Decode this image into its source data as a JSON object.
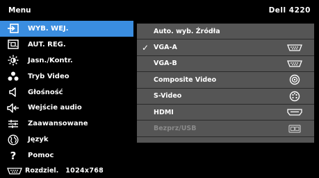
{
  "header": {
    "title": "Menu",
    "model": "Dell 4220"
  },
  "left_menu": {
    "items": [
      {
        "label": "WYB. WEJ.",
        "icon": "input-source-icon"
      },
      {
        "label": "AUT. REG.",
        "icon": "auto-adjust-icon"
      },
      {
        "label": "Jasn./Kontr.",
        "icon": "brightness-icon"
      },
      {
        "label": "Tryb Video",
        "icon": "video-mode-icon"
      },
      {
        "label": "Głośność",
        "icon": "speaker-icon"
      },
      {
        "label": "Wejście audio",
        "icon": "audio-input-icon"
      },
      {
        "label": "Zaawansowane",
        "icon": "advanced-settings-icon"
      },
      {
        "label": "Język",
        "icon": "language-icon"
      },
      {
        "label": "Pomoc",
        "icon": "help-icon"
      }
    ],
    "active_index": 0
  },
  "submenu": {
    "items": [
      {
        "label": "Auto. wyb. Źródła",
        "checked": false,
        "icon": "",
        "disabled": false
      },
      {
        "label": "VGA-A",
        "checked": true,
        "icon": "vga-connector-icon",
        "disabled": false
      },
      {
        "label": "VGA-B",
        "checked": false,
        "icon": "vga-connector-icon",
        "disabled": false
      },
      {
        "label": "Composite Video",
        "checked": false,
        "icon": "rca-connector-icon",
        "disabled": false
      },
      {
        "label": "S-Video",
        "checked": false,
        "icon": "s-video-connector-icon",
        "disabled": false
      },
      {
        "label": "HDMI",
        "checked": false,
        "icon": "hdmi-connector-icon",
        "disabled": false
      },
      {
        "label": "Bezprz/USB",
        "checked": false,
        "icon": "wireless-usb-icon",
        "disabled": true
      },
      {
        "label": "",
        "checked": false,
        "icon": "",
        "disabled": false
      }
    ]
  },
  "footer": {
    "resolution_label": "Rozdziel.",
    "resolution_value": "1024x768",
    "icon": "vga-connector-icon"
  },
  "colors": {
    "active": "#3a8de0",
    "panel": "#555555",
    "background": "#000000"
  }
}
